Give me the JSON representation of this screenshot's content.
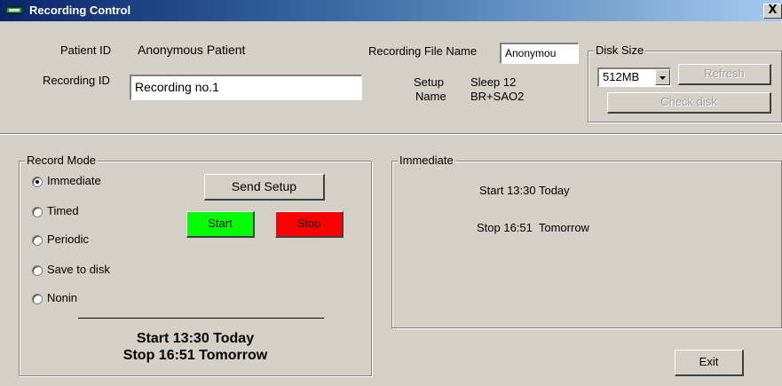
{
  "window": {
    "title": "Recording Control",
    "close_label": "X"
  },
  "patient": {
    "id_label": "Patient ID",
    "id_value": "Anonymous Patient"
  },
  "recording": {
    "id_label": "Recording ID",
    "id_value": "Recording no.1"
  },
  "file": {
    "label": "Recording File Name",
    "value": "Anonymou"
  },
  "setup": {
    "label_line1": "Setup",
    "label_line2": "Name",
    "value_line1": "Sleep 12",
    "value_line2": "BR+SAO2"
  },
  "disk": {
    "group_label": "Disk Size",
    "selected": "512MB",
    "refresh_label": "Refresh",
    "check_label": "Check disk"
  },
  "record_mode": {
    "group_label": "Record Mode",
    "options": [
      "Immediate",
      "Timed",
      "Periodic",
      "Save to disk",
      "Nonin"
    ],
    "selected": "Immediate",
    "send_setup_label": "Send Setup",
    "start_label": "Start",
    "stop_label": "Stop",
    "summary_start": "Start 13:30 Today",
    "summary_stop": "Stop 16:51 Tomorrow"
  },
  "immediate": {
    "group_label": "Immediate",
    "start_text": "Start 13:30 Today",
    "stop_text": "Stop 16:51  Tomorrow"
  },
  "exit_label": "Exit",
  "colors": {
    "start_button": "#00ff00",
    "stop_button": "#ff0000",
    "titlebar_dark": "#0a246a",
    "titlebar_light": "#a6caf0"
  }
}
